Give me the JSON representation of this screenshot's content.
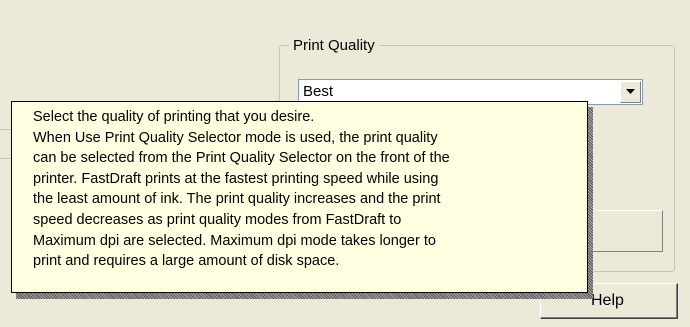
{
  "print_quality": {
    "group_label": "Print Quality",
    "selected_value": "Best"
  },
  "help_button": {
    "label": "Help"
  },
  "tooltip": {
    "lines": [
      "Select the quality of printing that you desire.",
      "When Use Print Quality Selector mode is used, the print quality",
      "can be selected from the Print Quality Selector on the front of the",
      "printer. FastDraft prints at the fastest printing speed while using",
      "the least amount of ink. The print quality increases and the print",
      "speed decreases as print quality modes from FastDraft to",
      "Maximum dpi are selected. Maximum dpi mode takes longer to",
      "print and requires a large amount of disk space."
    ]
  }
}
